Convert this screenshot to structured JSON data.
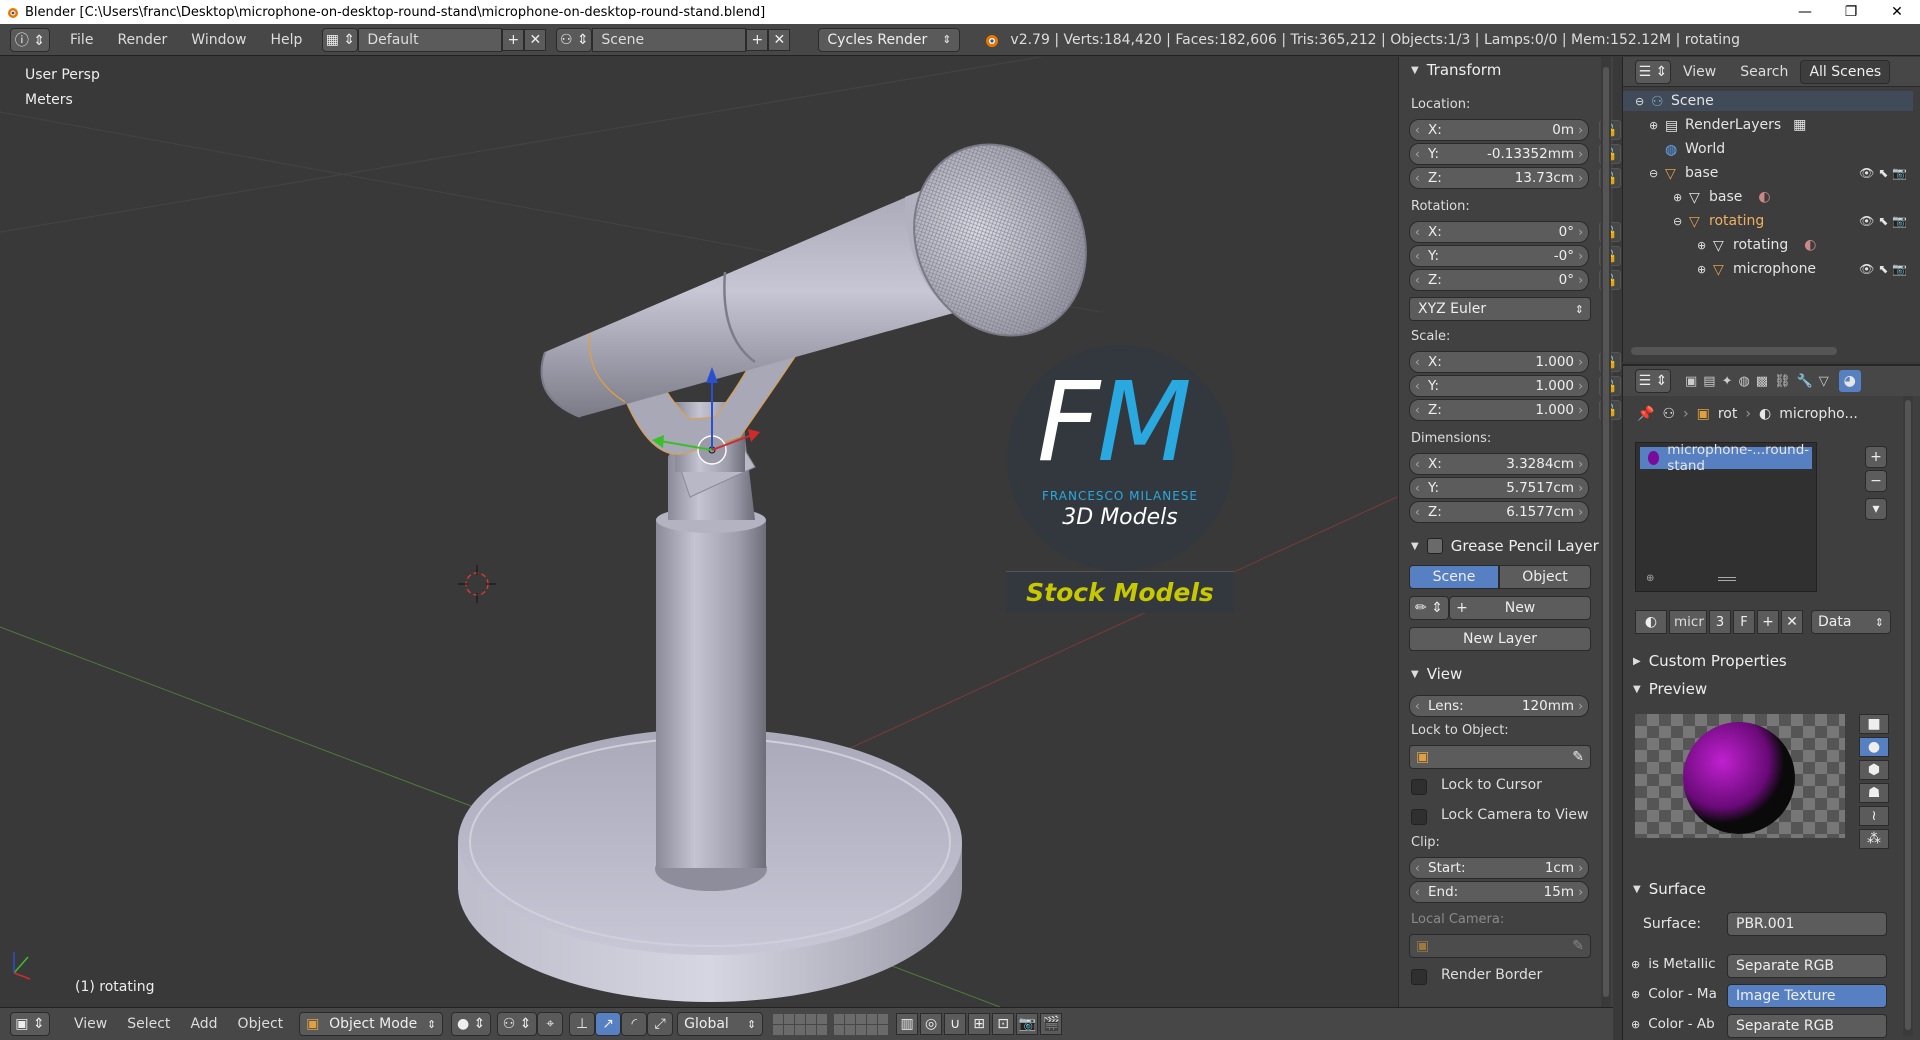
{
  "titlebar": {
    "text": "Blender [C:\\Users\\franc\\Desktop\\microphone-on-desktop-round-stand\\microphone-on-desktop-round-stand.blend]",
    "minimize": "—",
    "maximize": "❐",
    "close": "✕"
  },
  "infobar": {
    "menus": [
      "File",
      "Render",
      "Window",
      "Help"
    ],
    "layout": "Default",
    "scene": "Scene",
    "engine": "Cycles Render",
    "stats": "v2.79 | Verts:184,420 | Faces:182,606 | Tris:365,212 | Objects:1/3 | Lamps:0/0 | Mem:152.12M | rotating"
  },
  "viewport": {
    "view_name": "User Persp",
    "units": "Meters",
    "selected_info": "(1) rotating",
    "logo": {
      "initials_f": "F",
      "initials_m": "M",
      "name": "FRANCESCO MILANESE",
      "sub": "3D Models",
      "banner": "Stock Models"
    }
  },
  "npanel": {
    "transform": {
      "title": "Transform",
      "location_label": "Location:",
      "loc": [
        {
          "axis": "X:",
          "value": "0m"
        },
        {
          "axis": "Y:",
          "value": "-0.13352mm"
        },
        {
          "axis": "Z:",
          "value": "13.73cm"
        }
      ],
      "rotation_label": "Rotation:",
      "rot": [
        {
          "axis": "X:",
          "value": "0°"
        },
        {
          "axis": "Y:",
          "value": "-0°"
        },
        {
          "axis": "Z:",
          "value": "0°"
        }
      ],
      "rot_mode": "XYZ Euler",
      "scale_label": "Scale:",
      "scale": [
        {
          "axis": "X:",
          "value": "1.000"
        },
        {
          "axis": "Y:",
          "value": "1.000"
        },
        {
          "axis": "Z:",
          "value": "1.000"
        }
      ],
      "dimensions_label": "Dimensions:",
      "dim": [
        {
          "axis": "X:",
          "value": "3.3284cm"
        },
        {
          "axis": "Y:",
          "value": "5.7517cm"
        },
        {
          "axis": "Z:",
          "value": "6.1577cm"
        }
      ]
    },
    "grease": {
      "title": "Grease Pencil Layer",
      "scene_tab": "Scene",
      "object_tab": "Object",
      "new_label": "New",
      "new_layer": "New Layer"
    },
    "view": {
      "title": "View",
      "lens_label": "Lens:",
      "lens_value": "120mm",
      "lock_obj_label": "Lock to Object:",
      "lock_cursor": "Lock to Cursor",
      "lock_camera": "Lock Camera to View",
      "clip_label": "Clip:",
      "start_label": "Start:",
      "start_value": "1cm",
      "end_label": "End:",
      "end_value": "15m",
      "local_camera": "Local Camera:",
      "render_border": "Render Border"
    }
  },
  "outliner": {
    "view": "View",
    "search": "Search",
    "filter": "All Scenes",
    "items": [
      {
        "label": "Scene"
      },
      {
        "label": "RenderLayers"
      },
      {
        "label": "World"
      },
      {
        "label": "base"
      },
      {
        "label": "base"
      },
      {
        "label": "rotating"
      },
      {
        "label": "rotating"
      },
      {
        "label": "microphone"
      }
    ]
  },
  "properties": {
    "breadcrumb_obj": "rot",
    "breadcrumb_mat": "micropho...",
    "material_slot": "microphone-...round-stand",
    "mat_name": "micr",
    "mat_users": "3",
    "mat_fake": "F",
    "mat_link": "Data",
    "custom_props": "Custom Properties",
    "preview": "Preview",
    "surface_section": "Surface",
    "surface_label": "Surface:",
    "surface_value": "PBR.001",
    "rows": [
      {
        "label": "is Metallic",
        "value": "Separate RGB"
      },
      {
        "label": "Color - Ma",
        "value": "Image Texture"
      },
      {
        "label": "Color - Ab",
        "value": "Separate RGB"
      }
    ]
  },
  "viewheader": {
    "menus": [
      "View",
      "Select",
      "Add",
      "Object"
    ],
    "mode": "Object Mode",
    "orientation": "Global"
  },
  "colors": {
    "accent": "#5680c2",
    "background": "#393939",
    "panel": "#414141",
    "logo_blue": "#29a9e0",
    "logo_yellow": "#c8c800"
  }
}
